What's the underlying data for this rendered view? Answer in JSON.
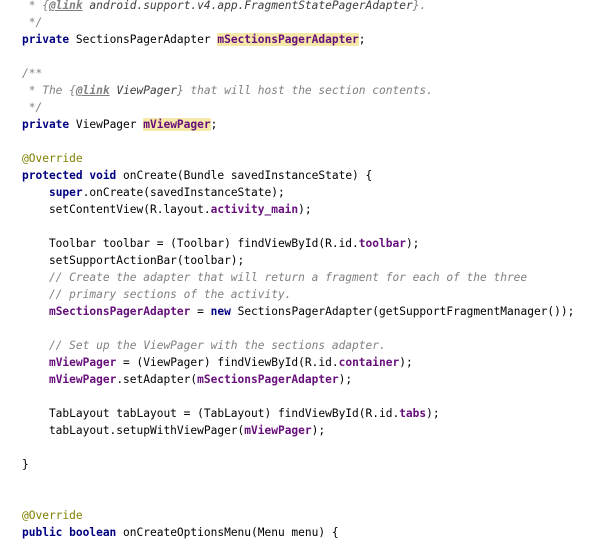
{
  "editor": {
    "lines": [
      [
        {
          "t": " * ",
          "c": "cmt"
        },
        {
          "t": "{",
          "c": "cmt"
        },
        {
          "t": "@link",
          "c": "tag"
        },
        {
          "t": " android.support.v4.app.FragmentStatePagerAdapter",
          "c": "doc-ref"
        },
        {
          "t": "}.",
          "c": "cmt"
        }
      ],
      [
        {
          "t": " */",
          "c": "cmt"
        }
      ],
      [
        {
          "t": "private ",
          "c": "kw"
        },
        {
          "t": "SectionsPagerAdapter ",
          "c": "plain"
        },
        {
          "t": "mSectionsPagerAdapter",
          "c": "fld hl"
        },
        {
          "t": ";",
          "c": "plain"
        }
      ],
      [],
      [
        {
          "t": "/**",
          "c": "cmt"
        }
      ],
      [
        {
          "t": " * The ",
          "c": "cmt"
        },
        {
          "t": "{",
          "c": "cmt"
        },
        {
          "t": "@link",
          "c": "tag"
        },
        {
          "t": " ViewPager",
          "c": "doc-ref"
        },
        {
          "t": "} that will host the section contents.",
          "c": "cmt"
        }
      ],
      [
        {
          "t": " */",
          "c": "cmt"
        }
      ],
      [
        {
          "t": "private ",
          "c": "kw"
        },
        {
          "t": "ViewPager ",
          "c": "plain"
        },
        {
          "t": "mViewPager",
          "c": "fld hl"
        },
        {
          "t": ";",
          "c": "plain"
        }
      ],
      [],
      [
        {
          "t": "@Override",
          "c": "ann"
        }
      ],
      [
        {
          "t": "protected void ",
          "c": "kw"
        },
        {
          "t": "onCreate(Bundle savedInstanceState) {",
          "c": "plain"
        }
      ],
      [
        {
          "t": "    ",
          "c": "plain"
        },
        {
          "t": "super",
          "c": "kw"
        },
        {
          "t": ".onCreate(savedInstanceState);",
          "c": "plain"
        }
      ],
      [
        {
          "t": "    setContentView(R.layout.",
          "c": "plain"
        },
        {
          "t": "activity_main",
          "c": "fld"
        },
        {
          "t": ");",
          "c": "plain"
        }
      ],
      [],
      [
        {
          "t": "    Toolbar toolbar = (Toolbar) findViewById(R.id.",
          "c": "plain"
        },
        {
          "t": "toolbar",
          "c": "fld"
        },
        {
          "t": ");",
          "c": "plain"
        }
      ],
      [
        {
          "t": "    setSupportActionBar(toolbar);",
          "c": "plain"
        }
      ],
      [
        {
          "t": "    // Create the adapter that will return a fragment for each of the three",
          "c": "cmt"
        }
      ],
      [
        {
          "t": "    // primary sections of the activity.",
          "c": "cmt"
        }
      ],
      [
        {
          "t": "    ",
          "c": "plain"
        },
        {
          "t": "mSectionsPagerAdapter",
          "c": "fld"
        },
        {
          "t": " = ",
          "c": "plain"
        },
        {
          "t": "new ",
          "c": "kw"
        },
        {
          "t": "SectionsPagerAdapter(getSupportFragmentManager());",
          "c": "plain"
        }
      ],
      [],
      [
        {
          "t": "    // Set up the ViewPager with the sections adapter.",
          "c": "cmt"
        }
      ],
      [
        {
          "t": "    ",
          "c": "plain"
        },
        {
          "t": "mViewPager",
          "c": "fld"
        },
        {
          "t": " = (ViewPager) findViewById(R.id.",
          "c": "plain"
        },
        {
          "t": "container",
          "c": "fld"
        },
        {
          "t": ");",
          "c": "plain"
        }
      ],
      [
        {
          "t": "    ",
          "c": "plain"
        },
        {
          "t": "mViewPager",
          "c": "fld"
        },
        {
          "t": ".setAdapter(",
          "c": "plain"
        },
        {
          "t": "mSectionsPagerAdapter",
          "c": "fld"
        },
        {
          "t": ");",
          "c": "plain"
        }
      ],
      [],
      [
        {
          "t": "    TabLayout tabLayout = (TabLayout) findViewById(R.id.",
          "c": "plain"
        },
        {
          "t": "tabs",
          "c": "fld"
        },
        {
          "t": ");",
          "c": "plain"
        }
      ],
      [
        {
          "t": "    tabLayout.setupWithViewPager(",
          "c": "plain"
        },
        {
          "t": "mViewPager",
          "c": "fld"
        },
        {
          "t": ");",
          "c": "plain"
        }
      ],
      [],
      [
        {
          "t": "}",
          "c": "plain"
        }
      ],
      [],
      [],
      [
        {
          "t": "@Override",
          "c": "ann"
        }
      ],
      [
        {
          "t": "public boolean ",
          "c": "kw"
        },
        {
          "t": "onCreateOptionsMenu(Menu menu) {",
          "c": "plain"
        }
      ]
    ]
  }
}
